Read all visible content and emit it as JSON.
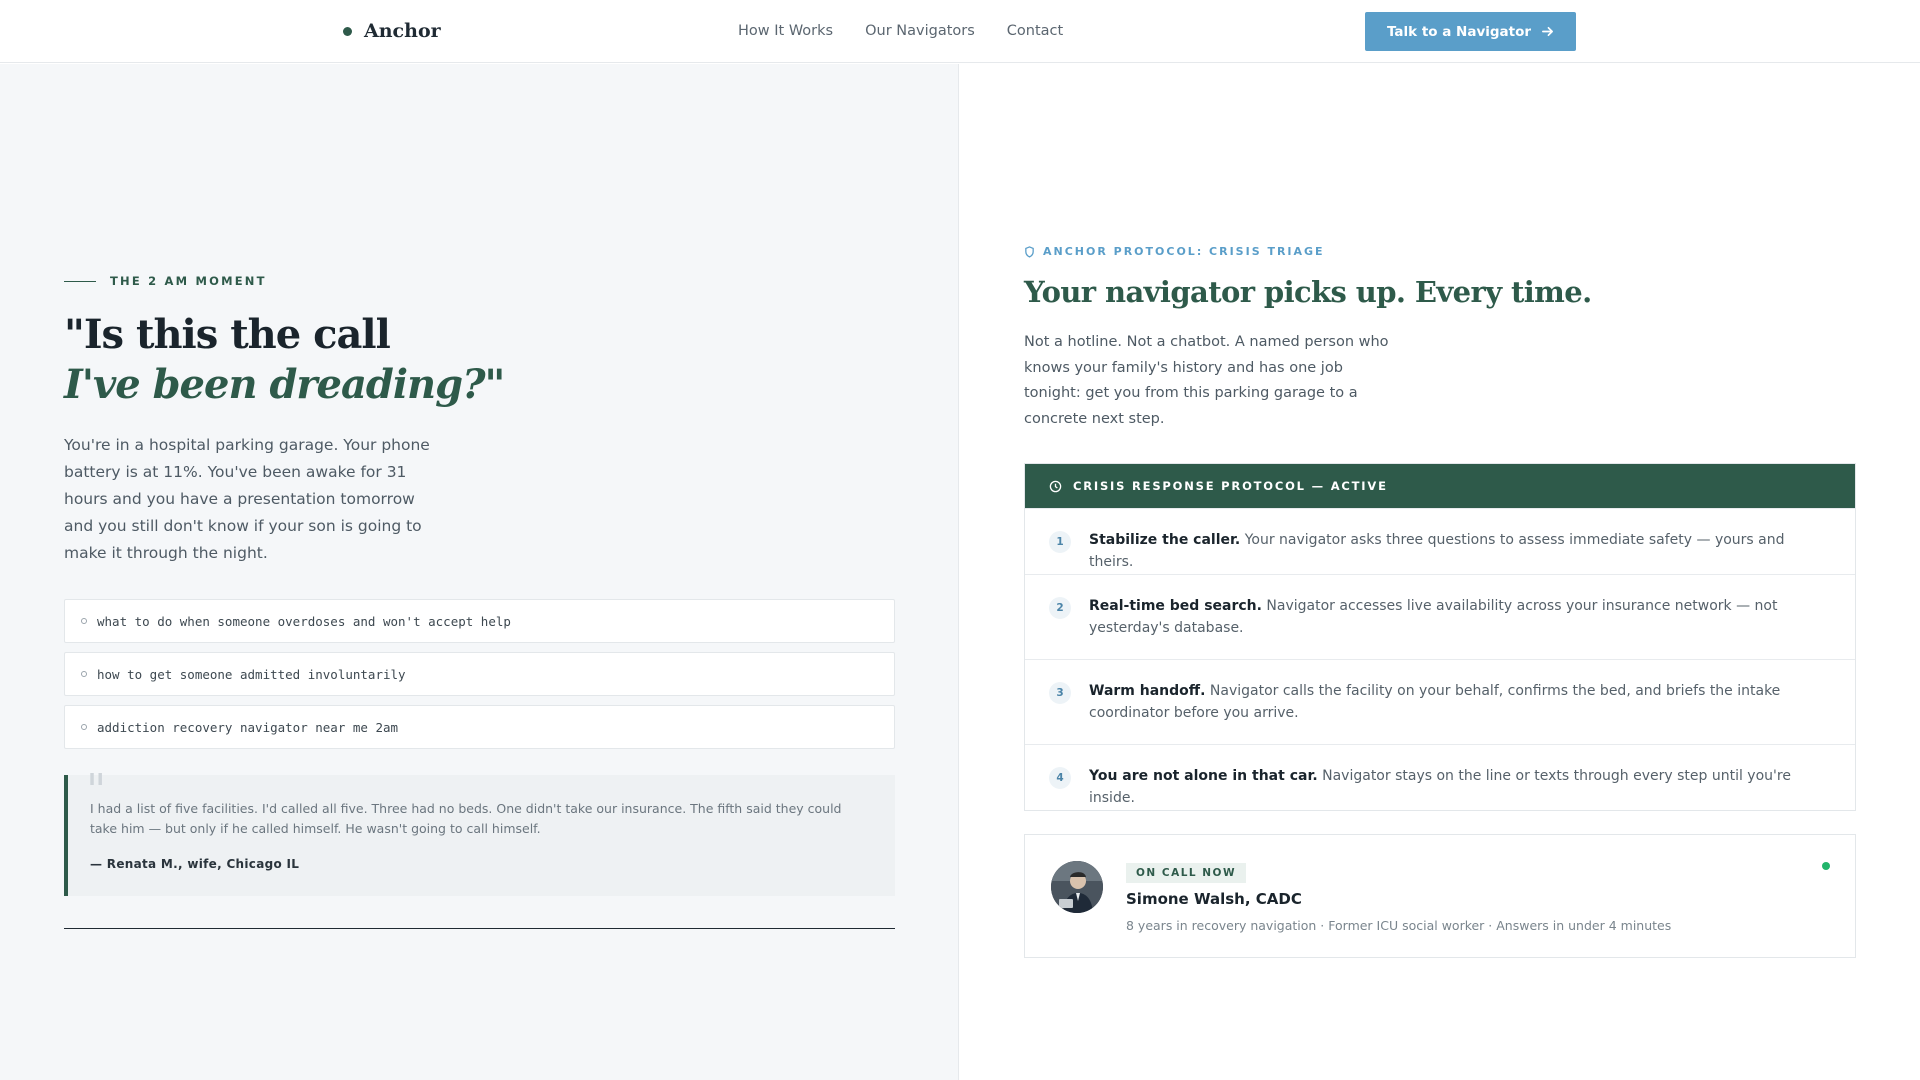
{
  "header": {
    "brand": "Anchor",
    "nav": [
      "How It Works",
      "Our Navigators",
      "Contact"
    ],
    "cta_label": "Talk to a Navigator"
  },
  "left": {
    "eyebrow": "THE 2 AM MOMENT",
    "headline_line1": "\"Is this the call",
    "headline_line2": "I've been dreading?\"",
    "story": "You're in a hospital parking garage. Your phone battery is at 11%. You've been awake for 31 hours and you have a presentation tomorrow and you still don't know if your son is going to make it through the night.",
    "queries": [
      "what to do when someone overdoses and won't accept help",
      "how to get someone admitted involuntarily",
      "addiction recovery navigator near me 2am"
    ],
    "quote": {
      "text": "I had a list of five facilities. I'd called all five. Three had no beds. One didn't take our insurance. The fifth said they could take him — but only if he called himself. He wasn't going to call himself.",
      "attribution": "— Renata M., wife, Chicago IL"
    }
  },
  "right": {
    "eyebrow": "ANCHOR PROTOCOL: CRISIS TRIAGE",
    "title": "Your navigator picks up. Every time.",
    "description": "Not a hotline. Not a chatbot. A named person who knows your family's history and has one job tonight: get you from this parking garage to a concrete next step.",
    "protocol": {
      "title": "CRISIS RESPONSE PROTOCOL — ACTIVE",
      "steps": [
        {
          "num": "1",
          "title": "Stabilize the caller.",
          "text": " Your navigator asks three questions to assess immediate safety — yours and theirs."
        },
        {
          "num": "2",
          "title": "Real-time bed search.",
          "text": " Navigator accesses live availability across your insurance network — not yesterday's database."
        },
        {
          "num": "3",
          "title": "Warm handoff.",
          "text": " Navigator calls the facility on your behalf, confirms the bed, and briefs the intake coordinator before you arrive."
        },
        {
          "num": "4",
          "title": "You are not alone in that car.",
          "text": " Navigator stays on the line or texts through every step until you're inside."
        }
      ]
    },
    "navigator": {
      "status": "ON CALL NOW",
      "name": "Simone Walsh, CADC",
      "meta": "8 years in recovery navigation · Former ICU social worker · Answers in under 4 minutes"
    }
  },
  "colors": {
    "brand_green": "#2e5a4a",
    "accent_blue": "#5a9ec9",
    "online_green": "#22b56b"
  },
  "icons": [
    "arrow-right-icon",
    "shield-icon",
    "clock-icon",
    "search-icon",
    "online-status-icon"
  ]
}
